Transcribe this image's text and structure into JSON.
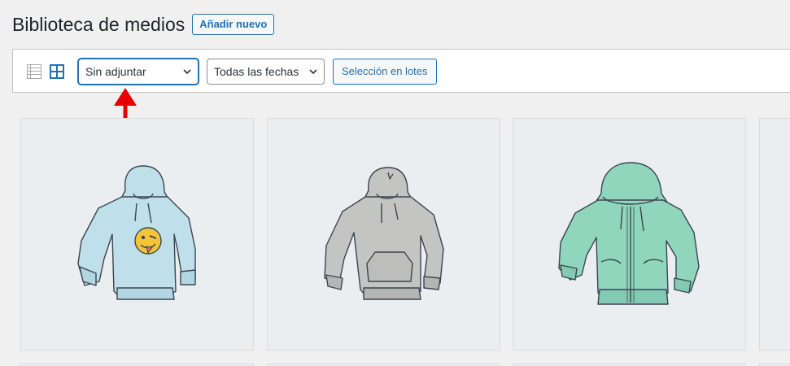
{
  "header": {
    "title": "Biblioteca de medios",
    "add_new_label": "Añadir nuevo"
  },
  "toolbar": {
    "view_modes": [
      {
        "name": "list",
        "icon": "list-view-icon",
        "active": false
      },
      {
        "name": "grid",
        "icon": "grid-view-icon",
        "active": true
      }
    ],
    "attachment_filter": {
      "selected": "Sin adjuntar"
    },
    "date_filter": {
      "selected": "Todas las fechas"
    },
    "bulk_select_label": "Selección en lotes"
  },
  "media_items": [
    {
      "icon": "light-blue-hoodie-with-emoji-image"
    },
    {
      "icon": "grey-hoodie-with-pocket-image"
    },
    {
      "icon": "teal-zip-hoodie-image"
    },
    {
      "icon": "partial-media-tile"
    }
  ],
  "colors": {
    "accent": "#2271b1",
    "annotation_arrow": "#e60000",
    "background": "#f0f0f1"
  }
}
